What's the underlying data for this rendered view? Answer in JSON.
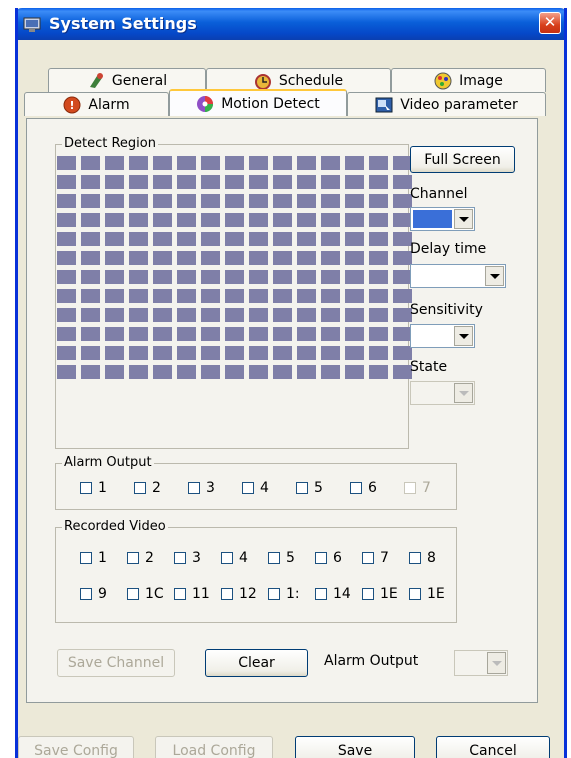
{
  "window": {
    "title": "System Settings",
    "close_symbol": "✕"
  },
  "tabs": {
    "row1": [
      {
        "label": "General",
        "icon": "general-icon"
      },
      {
        "label": "Schedule",
        "icon": "schedule-icon"
      },
      {
        "label": "Image",
        "icon": "image-icon"
      }
    ],
    "row2": [
      {
        "label": "Alarm",
        "icon": "alarm-icon"
      },
      {
        "label": "Motion Detect",
        "icon": "motion-detect-icon",
        "active": true
      },
      {
        "label": "Video parameter",
        "icon": "video-parameter-icon"
      }
    ]
  },
  "detect_region": {
    "legend": "Detect Region",
    "cols": 15,
    "rows": 12,
    "cell_color": "#7f7fa8"
  },
  "side": {
    "full_screen": "Full Screen",
    "channel_label": "Channel",
    "channel_color": "#3a6fd8",
    "delay_label": "Delay time",
    "sensitivity_label": "Sensitivity",
    "state_label": "State"
  },
  "alarm_output": {
    "legend": "Alarm Output",
    "items": [
      "1",
      "2",
      "3",
      "4",
      "5",
      "6",
      "7"
    ]
  },
  "recorded_video": {
    "legend": "Recorded Video",
    "row1": [
      "1",
      "2",
      "3",
      "4",
      "5",
      "6",
      "7",
      "8"
    ],
    "row2": [
      "9",
      "1C",
      "11",
      "12",
      "1:",
      "14",
      "1E",
      "1E"
    ]
  },
  "actions": {
    "save_channel": "Save Channel",
    "clear": "Clear",
    "alarm_output_label": "Alarm Output"
  },
  "footer": {
    "save_config": "Save Config",
    "load_config": "Load Config",
    "save": "Save",
    "cancel": "Cancel"
  }
}
